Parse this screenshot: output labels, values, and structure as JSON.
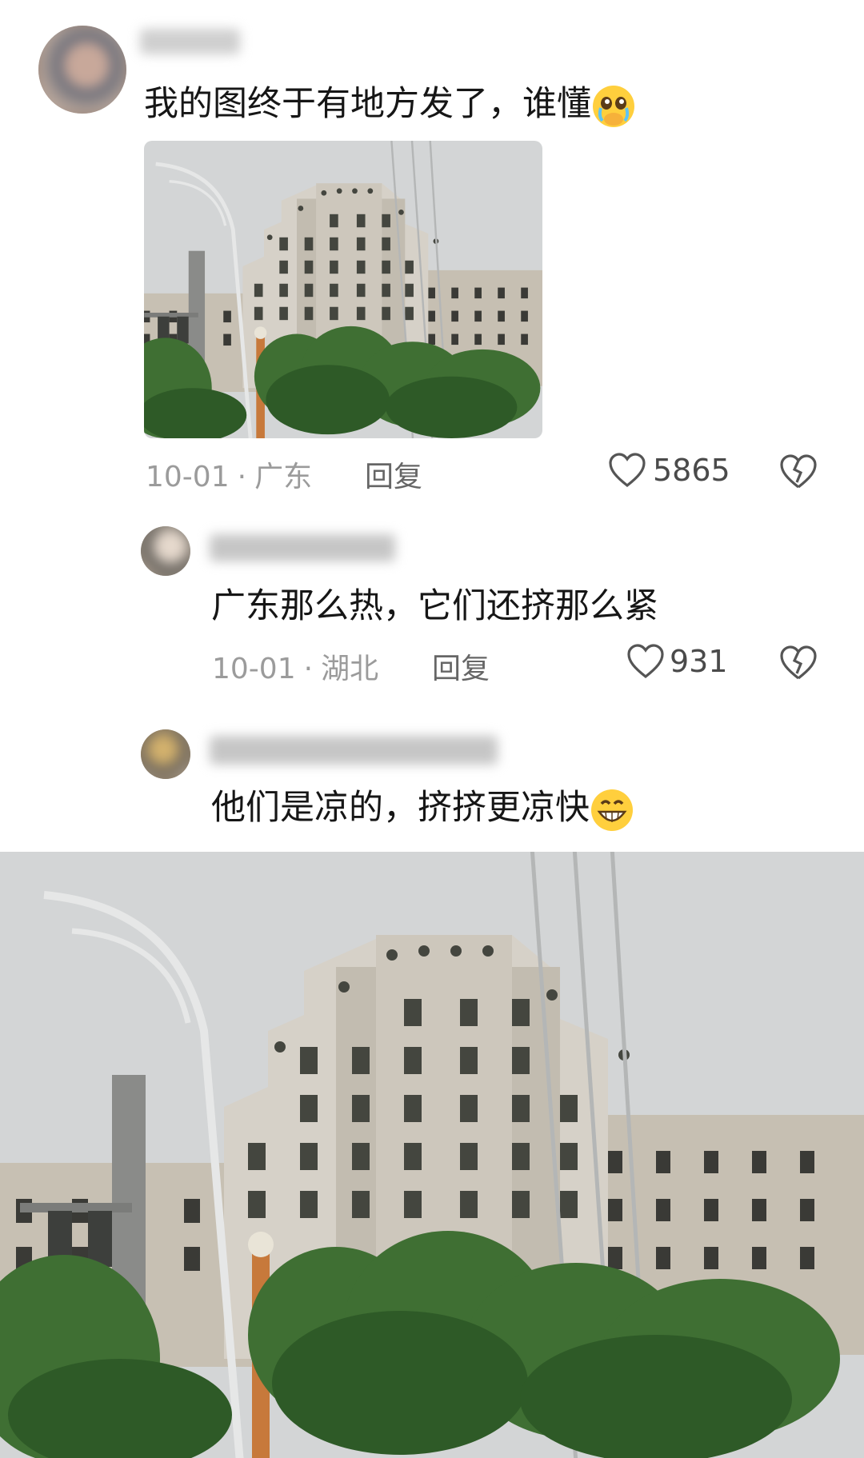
{
  "comments": [
    {
      "text": "我的图终于有地方发了，谁懂",
      "emoji": "pleading-crying-face",
      "date": "10-01",
      "region": "广东",
      "reply_label": "回复",
      "likes": "5865"
    },
    {
      "text": "广东那么热，它们还挤那么紧",
      "date": "10-01",
      "region": "湖北",
      "reply_label": "回复",
      "likes": "931"
    },
    {
      "text": "他们是凉的，挤挤更凉快",
      "emoji": "grinning-face"
    }
  ],
  "icons": {
    "like": "heart-outline-icon",
    "dislike": "broken-heart-icon"
  },
  "colors": {
    "text": "#161616",
    "meta": "#9b9b9b",
    "sky": "#d3d5d6",
    "building": "#c9c2b6"
  }
}
